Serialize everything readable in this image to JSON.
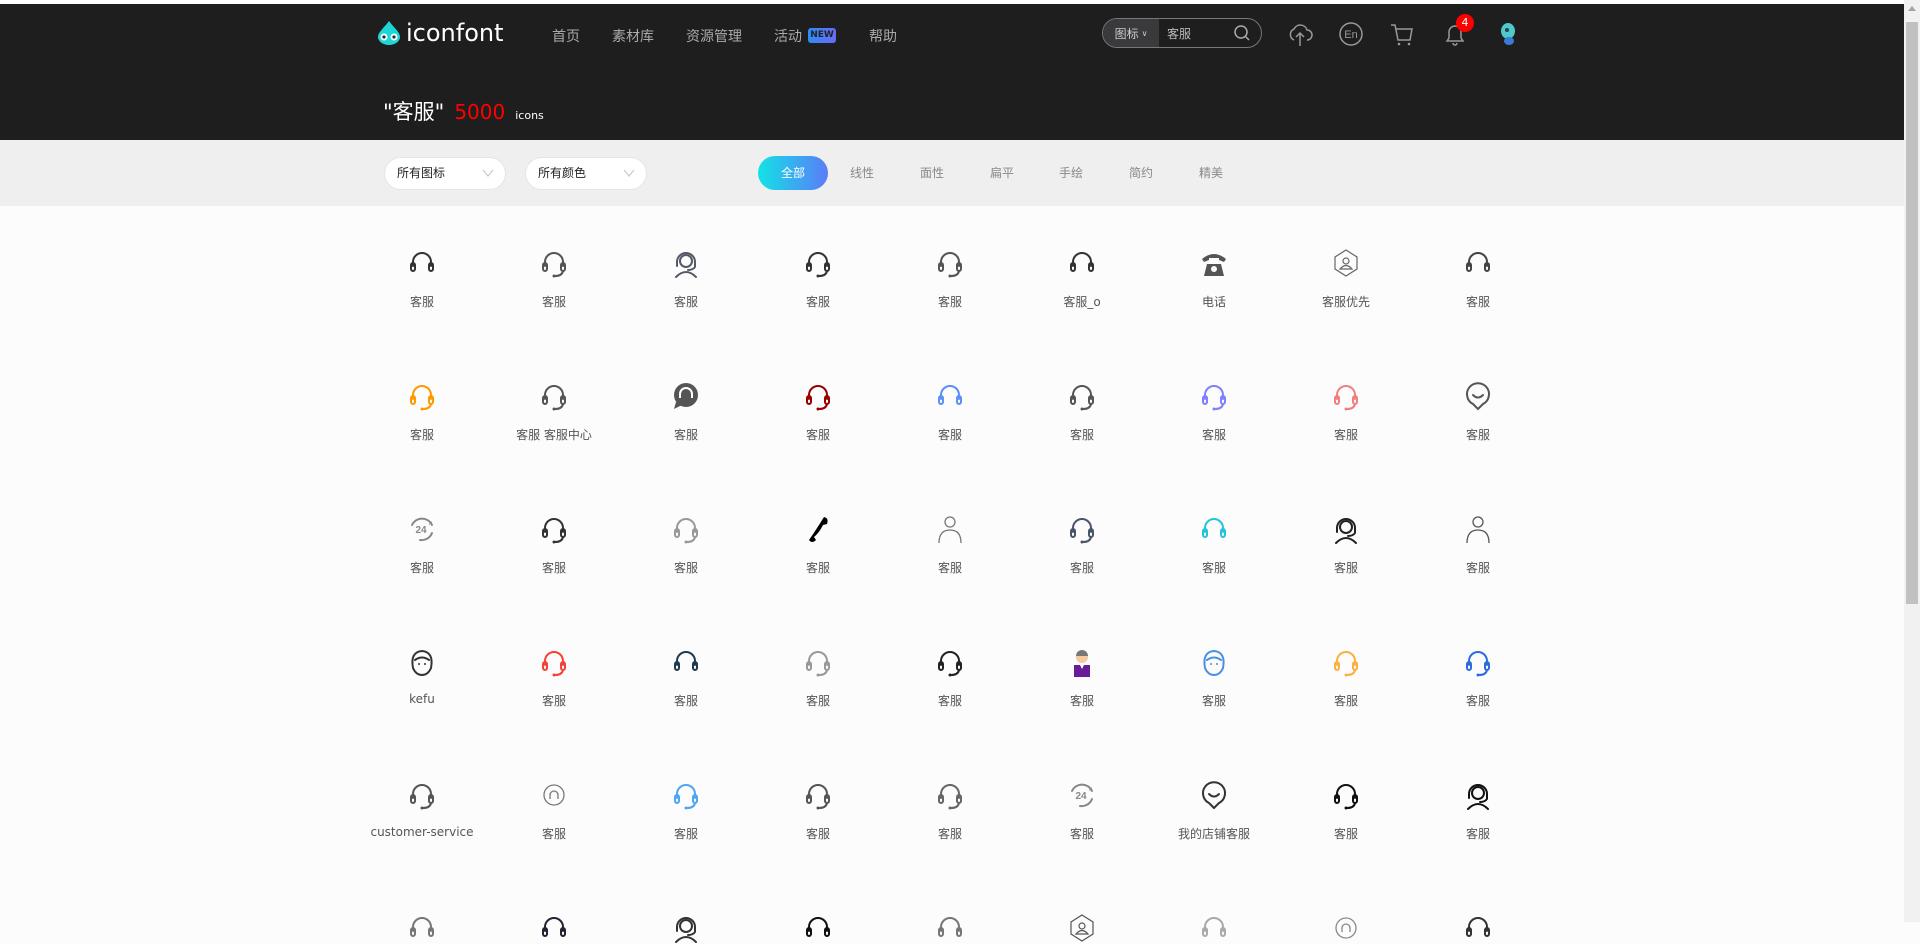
{
  "header": {
    "logo_text": "iconfont",
    "nav": [
      {
        "label": "首页"
      },
      {
        "label": "素材库"
      },
      {
        "label": "资源管理"
      },
      {
        "label": "活动"
      },
      {
        "label": "帮助"
      }
    ],
    "new_badge": "NEW",
    "search": {
      "type": "图标",
      "query": "客服"
    },
    "notification_count": "4"
  },
  "result": {
    "keyword": "\"客服\"",
    "count": "5000",
    "unit": "icons"
  },
  "filters": {
    "icon_type": "所有图标",
    "color": "所有颜色",
    "tabs": [
      {
        "label": "全部"
      },
      {
        "label": "线性"
      },
      {
        "label": "面性"
      },
      {
        "label": "扁平"
      },
      {
        "label": "手绘"
      },
      {
        "label": "简约"
      },
      {
        "label": "精美"
      }
    ]
  },
  "icons": [
    {
      "label": "客服",
      "icon": "headset",
      "color": "#333333"
    },
    {
      "label": "客服",
      "icon": "headset-mic",
      "color": "#555555"
    },
    {
      "label": "客服",
      "icon": "agent",
      "color": "#555a66"
    },
    {
      "label": "客服",
      "icon": "headset-mic",
      "color": "#333333"
    },
    {
      "label": "客服",
      "icon": "headset-mic",
      "color": "#555555"
    },
    {
      "label": "客服_o",
      "icon": "headset",
      "color": "#333333"
    },
    {
      "label": "电话",
      "icon": "phone-classic",
      "color": "#555555"
    },
    {
      "label": "客服优先",
      "icon": "hexagon-agent",
      "color": "#666666"
    },
    {
      "label": "客服",
      "icon": "headset",
      "color": "#444444"
    },
    {
      "label": "客服",
      "icon": "headset-mic",
      "color": "#ff9900"
    },
    {
      "label": "客服 客服中心",
      "icon": "headset-mic",
      "color": "#555555"
    },
    {
      "label": "客服",
      "icon": "chat-bubble",
      "color": "#555555"
    },
    {
      "label": "客服",
      "icon": "headset-mic",
      "color": "#990000"
    },
    {
      "label": "客服",
      "icon": "headset",
      "color": "#5b8ff9"
    },
    {
      "label": "客服",
      "icon": "headset-mic",
      "color": "#555555"
    },
    {
      "label": "客服",
      "icon": "headset-mic",
      "color": "#8080ff"
    },
    {
      "label": "客服",
      "icon": "headset-mic",
      "color": "#f08080"
    },
    {
      "label": "客服",
      "icon": "chat-smile",
      "color": "#555555"
    },
    {
      "label": "客服",
      "icon": "24h",
      "color": "#888888"
    },
    {
      "label": "客服",
      "icon": "headset-mic",
      "color": "#333333"
    },
    {
      "label": "客服",
      "icon": "headset-mic",
      "color": "#999999"
    },
    {
      "label": "客服",
      "icon": "phone-handset",
      "color": "#000000"
    },
    {
      "label": "客服",
      "icon": "person",
      "color": "#777777"
    },
    {
      "label": "客服",
      "icon": "headset-mic",
      "color": "#4a5568"
    },
    {
      "label": "客服",
      "icon": "headset",
      "color": "#22c5d9"
    },
    {
      "label": "客服",
      "icon": "agent",
      "color": "#222222"
    },
    {
      "label": "客服",
      "icon": "person",
      "color": "#555555"
    },
    {
      "label": "kefu",
      "icon": "face",
      "color": "#333333"
    },
    {
      "label": "客服",
      "icon": "headset-mic",
      "color": "#f44336"
    },
    {
      "label": "客服",
      "icon": "headset",
      "color": "#1f3a4d"
    },
    {
      "label": "客服",
      "icon": "headset-mic",
      "color": "#999999"
    },
    {
      "label": "客服",
      "icon": "headset-mic",
      "color": "#222222"
    },
    {
      "label": "客服",
      "icon": "agent-purple",
      "color": "#6a1b9a"
    },
    {
      "label": "客服",
      "icon": "face",
      "color": "#4a90e2"
    },
    {
      "label": "客服",
      "icon": "headset-mic",
      "color": "#fbb040"
    },
    {
      "label": "客服",
      "icon": "headset-mic",
      "color": "#2b6de0"
    },
    {
      "label": "customer-service",
      "icon": "headset-mic",
      "color": "#555555"
    },
    {
      "label": "客服",
      "icon": "circle-headset",
      "color": "#777777"
    },
    {
      "label": "客服",
      "icon": "headset-mic",
      "color": "#4ea4f5"
    },
    {
      "label": "客服",
      "icon": "headset-mic",
      "color": "#555555"
    },
    {
      "label": "客服",
      "icon": "headset-mic",
      "color": "#666666"
    },
    {
      "label": "客服",
      "icon": "24h",
      "color": "#888888"
    },
    {
      "label": "我的店铺客服",
      "icon": "chat-smile",
      "color": "#333333"
    },
    {
      "label": "客服",
      "icon": "headset-mic",
      "color": "#111111"
    },
    {
      "label": "客服",
      "icon": "agent",
      "color": "#111111"
    },
    {
      "icon": "headset",
      "color": "#777777"
    },
    {
      "icon": "headset",
      "color": "#222233"
    },
    {
      "icon": "agent",
      "color": "#333333"
    },
    {
      "icon": "headset",
      "color": "#111111"
    },
    {
      "icon": "headset",
      "color": "#777777"
    },
    {
      "icon": "hexagon-agent",
      "color": "#555555"
    },
    {
      "icon": "headset",
      "color": "#aaaaaa"
    },
    {
      "icon": "circle-headset",
      "color": "#888888"
    },
    {
      "icon": "headset",
      "color": "#333333"
    }
  ]
}
